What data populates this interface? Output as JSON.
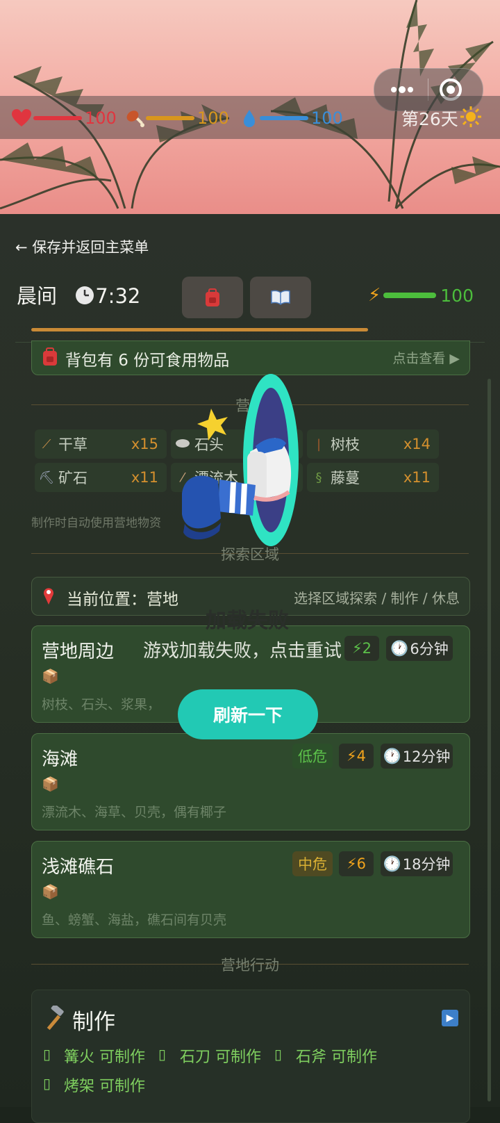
{
  "hud": {
    "health": {
      "value": "100",
      "fraction": 1.0,
      "color": "#e0353f"
    },
    "food": {
      "value": "100",
      "fraction": 1.0,
      "color": "#d8961e"
    },
    "water": {
      "value": "100",
      "fraction": 1.0,
      "color": "#3a8ed8"
    },
    "day": "第26天",
    "day_icon": "sun-icon"
  },
  "capsule": {
    "more_icon": "more-dots-icon",
    "close_icon": "target-icon"
  },
  "nav": {
    "back_label": "← 保存并返回主菜单"
  },
  "time": {
    "period": "晨间",
    "clock": "7:32",
    "clock_icon": "clock-icon"
  },
  "toolbar": {
    "backpack_icon": "backpack-icon",
    "book_icon": "book-icon"
  },
  "energy": {
    "value": "100",
    "fraction": 1.0,
    "color": "#4cbd3c"
  },
  "day_progress": 0.77,
  "food_notice": {
    "text": "背包有 6 份可食用物品",
    "action": "点击查看 ▶"
  },
  "camp": {
    "section_title": "营地",
    "resources": [
      {
        "name": "干草",
        "count": "x15",
        "icon": "hay-icon"
      },
      {
        "name": "石头",
        "count": "",
        "icon": "stone-icon"
      },
      {
        "name": "树枝",
        "count": "x14",
        "icon": "branch-icon"
      },
      {
        "name": "矿石",
        "count": "x11",
        "icon": "ore-icon"
      },
      {
        "name": "漂流木",
        "count": "",
        "icon": "driftwood-icon"
      },
      {
        "name": "藤蔓",
        "count": "x11",
        "icon": "vine-icon"
      }
    ],
    "hint": "制作时自动使用营地物资"
  },
  "explore": {
    "section_title": "探索区域",
    "location_label": "当前位置：营地",
    "location_hint": "选择区域探索 / 制作 / 休息",
    "areas": [
      {
        "title": "营地周边",
        "risk": "",
        "energy": "⚡2",
        "duration": "6分钟",
        "desc": "树枝、石头、浆果，"
      },
      {
        "title": "海滩",
        "risk": "低危",
        "energy": "⚡4",
        "duration": "12分钟",
        "desc": "漂流木、海草、贝壳，偶有椰子"
      },
      {
        "title": "浅滩礁石",
        "risk": "中危",
        "energy": "⚡6",
        "duration": "18分钟",
        "desc": "鱼、螃蟹、海盐，礁石间有贝壳"
      }
    ]
  },
  "camp_actions": {
    "section_title": "营地行动",
    "craft_title": "制作",
    "craft_icon": "hammer-icon",
    "items": [
      "篝火 可制作",
      "石刀 可制作",
      "石斧 可制作",
      "烤架 可制作"
    ]
  },
  "error_overlay": {
    "title": "加载失败",
    "message": "游戏加载失败，点击重试",
    "button": "刷新一下"
  },
  "colors": {
    "panel_bg": "#283026",
    "card_bg": "#2f4a2d",
    "accent_orange": "#d4902e",
    "accent_green": "#7fcf5f",
    "reload_teal": "#22c9b4",
    "low_risk": "#5cc04a",
    "mid_risk": "#d9b033"
  }
}
